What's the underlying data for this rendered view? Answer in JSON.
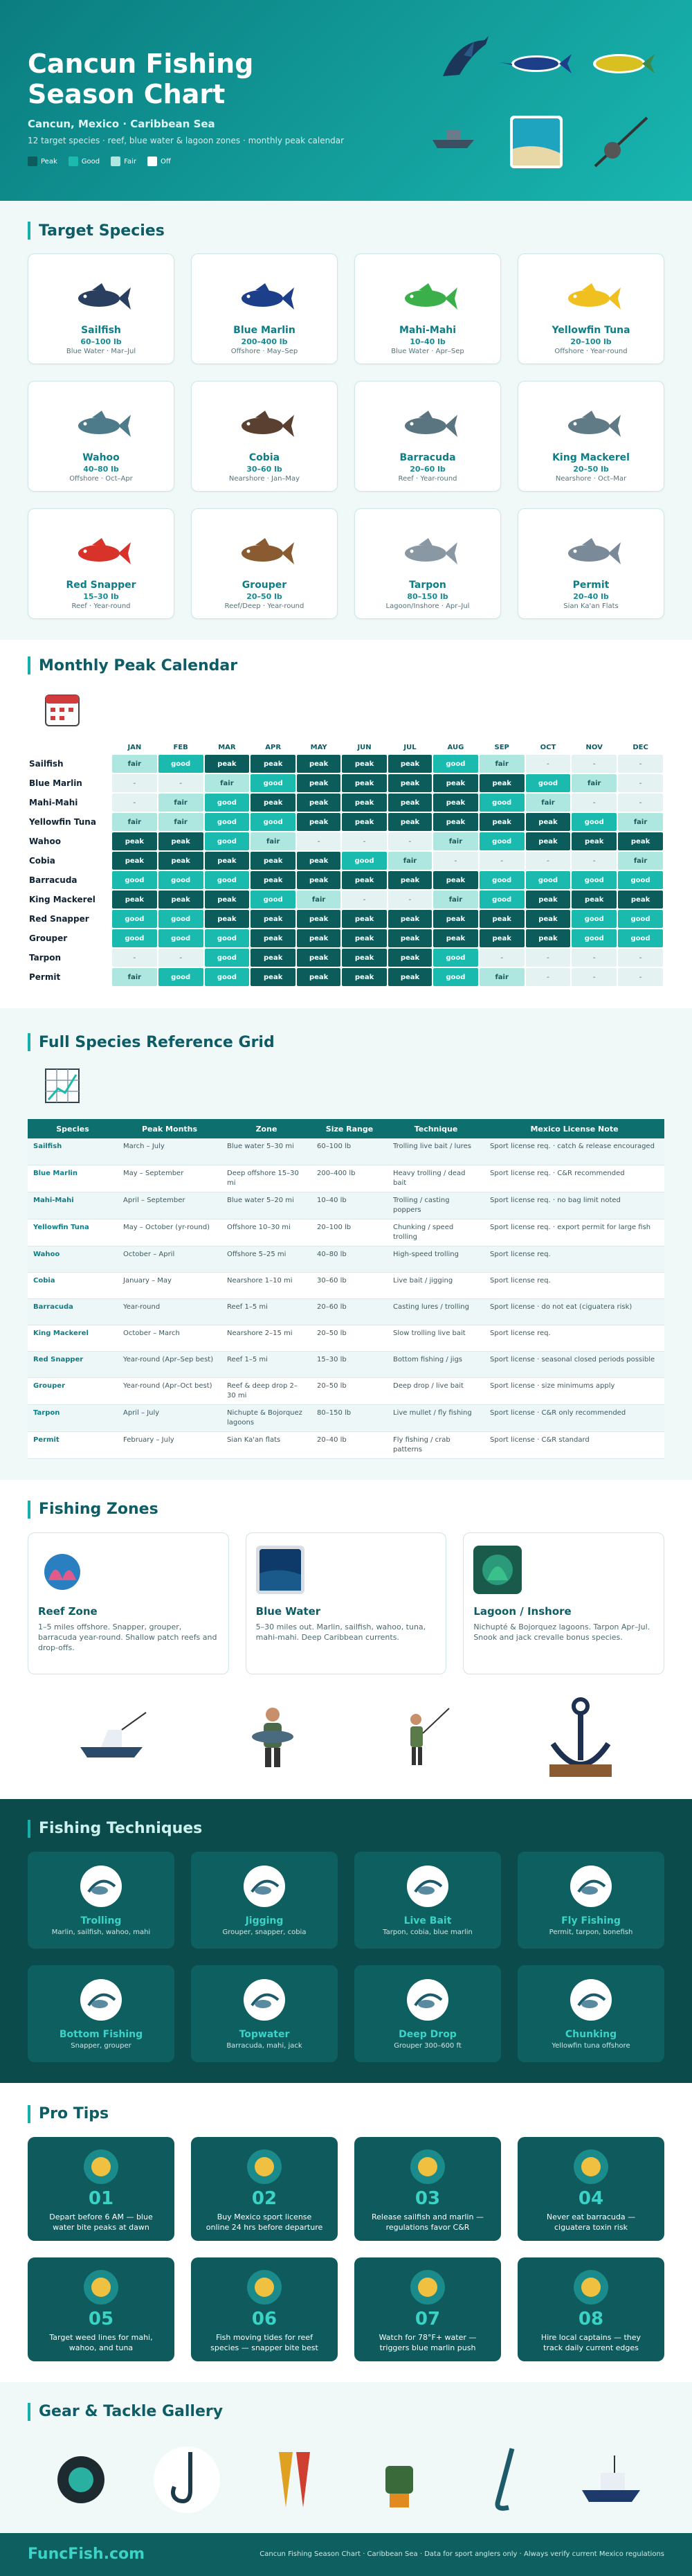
{
  "hero": {
    "title": "Cancun Fishing Season Chart",
    "subtitle": "Cancun, Mexico · Caribbean Sea",
    "description": "12 target species · reef, blue water & lagoon zones · monthly peak calendar",
    "legend": [
      {
        "label": "Peak",
        "color": "#0c5c5c"
      },
      {
        "label": "Good",
        "color": "#1abaae"
      },
      {
        "label": "Fair",
        "color": "#aee6e0"
      },
      {
        "label": "Off",
        "color": "#ffffff"
      }
    ]
  },
  "species_section": {
    "title": "Target Species"
  },
  "species": [
    {
      "name": "Sailfish",
      "weight": "60–100 lb",
      "desc": "Blue Water · Mar–Jul",
      "color": "#2a3f60",
      "icon": "sailfish-icon"
    },
    {
      "name": "Blue Marlin",
      "weight": "200–400 lb",
      "desc": "Offshore · May–Sep",
      "color": "#1d3f8a",
      "icon": "marlin-icon"
    },
    {
      "name": "Mahi-Mahi",
      "weight": "10–40 lb",
      "desc": "Blue Water · Apr–Sep",
      "color": "#3bb04a",
      "icon": "mahi-icon"
    },
    {
      "name": "Yellowfin Tuna",
      "weight": "20–100 lb",
      "desc": "Offshore · Year-round",
      "color": "#f0c020",
      "icon": "tuna-icon"
    },
    {
      "name": "Wahoo",
      "weight": "40–80 lb",
      "desc": "Offshore · Oct–Apr",
      "color": "#4d7b8a",
      "icon": "wahoo-icon"
    },
    {
      "name": "Cobia",
      "weight": "30–60 lb",
      "desc": "Nearshore · Jan–May",
      "color": "#5a4030",
      "icon": "cobia-icon"
    },
    {
      "name": "Barracuda",
      "weight": "20–60 lb",
      "desc": "Reef · Year-round",
      "color": "#5a7580",
      "icon": "barracuda-icon"
    },
    {
      "name": "King Mackerel",
      "weight": "20–50 lb",
      "desc": "Nearshore · Oct–Mar",
      "color": "#607a86",
      "icon": "mackerel-icon"
    },
    {
      "name": "Red Snapper",
      "weight": "15–30 lb",
      "desc": "Reef · Year-round",
      "color": "#d8332a",
      "icon": "snapper-icon"
    },
    {
      "name": "Grouper",
      "weight": "20–50 lb",
      "desc": "Reef/Deep · Year-round",
      "color": "#8a5a30",
      "icon": "grouper-icon"
    },
    {
      "name": "Tarpon",
      "weight": "80–150 lb",
      "desc": "Lagoon/Inshore · Apr–Jul",
      "color": "#8a98a4",
      "icon": "tarpon-icon"
    },
    {
      "name": "Permit",
      "weight": "20–40 lb",
      "desc": "Sian Ka'an Flats",
      "color": "#7a8a98",
      "icon": "permit-icon"
    }
  ],
  "calendar": {
    "title": "Monthly Peak Calendar",
    "icon": "calendar-icon",
    "months": [
      "JAN",
      "FEB",
      "MAR",
      "APR",
      "MAY",
      "JUN",
      "JUL",
      "AUG",
      "SEP",
      "OCT",
      "NOV",
      "DEC"
    ],
    "rows": [
      {
        "species": "Sailfish",
        "cells": [
          "fair",
          "good",
          "peak",
          "peak",
          "peak",
          "peak",
          "peak",
          "good",
          "fair",
          "-",
          "-",
          "-"
        ]
      },
      {
        "species": "Blue Marlin",
        "cells": [
          "-",
          "-",
          "fair",
          "good",
          "peak",
          "peak",
          "peak",
          "peak",
          "peak",
          "good",
          "fair",
          "-"
        ]
      },
      {
        "species": "Mahi-Mahi",
        "cells": [
          "-",
          "fair",
          "good",
          "peak",
          "peak",
          "peak",
          "peak",
          "peak",
          "good",
          "fair",
          "-",
          "-"
        ]
      },
      {
        "species": "Yellowfin Tuna",
        "cells": [
          "fair",
          "fair",
          "good",
          "good",
          "peak",
          "peak",
          "peak",
          "peak",
          "peak",
          "peak",
          "good",
          "fair"
        ]
      },
      {
        "species": "Wahoo",
        "cells": [
          "peak",
          "peak",
          "good",
          "fair",
          "-",
          "-",
          "-",
          "fair",
          "good",
          "peak",
          "peak",
          "peak"
        ]
      },
      {
        "species": "Cobia",
        "cells": [
          "peak",
          "peak",
          "peak",
          "peak",
          "peak",
          "good",
          "fair",
          "-",
          "-",
          "-",
          "-",
          "fair"
        ]
      },
      {
        "species": "Barracuda",
        "cells": [
          "good",
          "good",
          "good",
          "peak",
          "peak",
          "peak",
          "peak",
          "peak",
          "good",
          "good",
          "good",
          "good"
        ]
      },
      {
        "species": "King Mackerel",
        "cells": [
          "peak",
          "peak",
          "peak",
          "good",
          "fair",
          "-",
          "-",
          "fair",
          "good",
          "peak",
          "peak",
          "peak"
        ]
      },
      {
        "species": "Red Snapper",
        "cells": [
          "good",
          "good",
          "peak",
          "peak",
          "peak",
          "peak",
          "peak",
          "peak",
          "peak",
          "peak",
          "good",
          "good"
        ]
      },
      {
        "species": "Grouper",
        "cells": [
          "good",
          "good",
          "good",
          "peak",
          "peak",
          "peak",
          "peak",
          "peak",
          "peak",
          "peak",
          "good",
          "good"
        ]
      },
      {
        "species": "Tarpon",
        "cells": [
          "-",
          "-",
          "good",
          "peak",
          "peak",
          "peak",
          "peak",
          "good",
          "-",
          "-",
          "-",
          "-"
        ]
      },
      {
        "species": "Permit",
        "cells": [
          "fair",
          "good",
          "good",
          "peak",
          "peak",
          "peak",
          "peak",
          "good",
          "fair",
          "-",
          "-",
          "-"
        ]
      }
    ]
  },
  "reference": {
    "title": "Full Species Reference Grid",
    "icon": "grid-chart-icon",
    "columns": [
      "Species",
      "Peak Months",
      "Zone",
      "Size Range",
      "Technique",
      "Mexico License Note"
    ],
    "rows": [
      [
        "Sailfish",
        "March – July",
        "Blue water 5–30 mi",
        "60–100 lb",
        "Trolling live bait / lures",
        "Sport license req. · catch & release encouraged"
      ],
      [
        "Blue Marlin",
        "May – September",
        "Deep offshore 15–30 mi",
        "200–400 lb",
        "Heavy trolling / dead bait",
        "Sport license req. · C&R recommended"
      ],
      [
        "Mahi-Mahi",
        "April – September",
        "Blue water 5–20 mi",
        "10–40 lb",
        "Trolling / casting poppers",
        "Sport license req. · no bag limit noted"
      ],
      [
        "Yellowfin Tuna",
        "May – October (yr-round)",
        "Offshore 10–30 mi",
        "20–100 lb",
        "Chunking / speed trolling",
        "Sport license req. · export permit for large fish"
      ],
      [
        "Wahoo",
        "October – April",
        "Offshore 5–25 mi",
        "40–80 lb",
        "High-speed trolling",
        "Sport license req."
      ],
      [
        "Cobia",
        "January – May",
        "Nearshore 1–10 mi",
        "30–60 lb",
        "Live bait / jigging",
        "Sport license req."
      ],
      [
        "Barracuda",
        "Year-round",
        "Reef 1–5 mi",
        "20–60 lb",
        "Casting lures / trolling",
        "Sport license · do not eat (ciguatera risk)"
      ],
      [
        "King Mackerel",
        "October – March",
        "Nearshore 2–15 mi",
        "20–50 lb",
        "Slow trolling live bait",
        "Sport license req."
      ],
      [
        "Red Snapper",
        "Year-round (Apr–Sep best)",
        "Reef 1–5 mi",
        "15–30 lb",
        "Bottom fishing / jigs",
        "Sport license · seasonal closed periods possible"
      ],
      [
        "Grouper",
        "Year-round (Apr–Oct best)",
        "Reef & deep drop 2–30 mi",
        "20–50 lb",
        "Deep drop / live bait",
        "Sport license · size minimums apply"
      ],
      [
        "Tarpon",
        "April – July",
        "Nichupte & Bojorquez lagoons",
        "80–150 lb",
        "Live mullet / fly fishing",
        "Sport license · C&R only recommended"
      ],
      [
        "Permit",
        "February – July",
        "Sian Ka'an flats",
        "20–40 lb",
        "Fly fishing / crab patterns",
        "Sport license · C&R standard"
      ]
    ]
  },
  "zones": {
    "title": "Fishing Zones",
    "items": [
      {
        "name": "Reef Zone",
        "desc": "1–5 miles offshore. Snapper, grouper, barracuda year-round. Shallow patch reefs and drop-offs.",
        "icon": "reef-icon"
      },
      {
        "name": "Blue Water",
        "desc": "5–30 miles out. Marlin, sailfish, wahoo, tuna, mahi-mahi. Deep Caribbean currents.",
        "icon": "ocean-icon"
      },
      {
        "name": "Lagoon / Inshore",
        "desc": "Nichupté & Bojorquez lagoons. Tarpon Apr–Jul. Snook and jack crevalle bonus species.",
        "icon": "lagoon-icon"
      }
    ]
  },
  "techniques": {
    "title": "Fishing Techniques",
    "items": [
      {
        "name": "Trolling",
        "desc": "Marlin, sailfish, wahoo, mahi",
        "icon": "trolling-icon"
      },
      {
        "name": "Jigging",
        "desc": "Grouper, snapper, cobia",
        "icon": "jig-icon"
      },
      {
        "name": "Live Bait",
        "desc": "Tarpon, cobia, blue marlin",
        "icon": "bait-bucket-icon"
      },
      {
        "name": "Fly Fishing",
        "desc": "Permit, tarpon, bonefish",
        "icon": "fly-rod-icon"
      },
      {
        "name": "Bottom Fishing",
        "desc": "Snapper, grouper",
        "icon": "bottom-rig-icon"
      },
      {
        "name": "Topwater",
        "desc": "Barracuda, mahi, jack",
        "icon": "popper-lure-icon"
      },
      {
        "name": "Deep Drop",
        "desc": "Grouper 300–600 ft",
        "icon": "electric-reel-icon"
      },
      {
        "name": "Chunking",
        "desc": "Yellowfin tuna offshore",
        "icon": "chum-icon"
      }
    ]
  },
  "tips": {
    "title": "Pro Tips",
    "items": [
      {
        "num": "01",
        "text": "Depart before 6 AM — blue water bite peaks at dawn",
        "icon": "sunrise-icon"
      },
      {
        "num": "02",
        "text": "Buy Mexico sport license online 24 hrs before departure",
        "icon": "license-icon"
      },
      {
        "num": "03",
        "text": "Release sailfish and marlin — regulations favor C&R",
        "icon": "release-fish-icon"
      },
      {
        "num": "04",
        "text": "Never eat barracuda — ciguatera toxin risk",
        "icon": "no-fish-icon"
      },
      {
        "num": "05",
        "text": "Target weed lines for mahi, wahoo, and tuna",
        "icon": "seaweed-icon"
      },
      {
        "num": "06",
        "text": "Fish moving tides for reef species — snapper bite best",
        "icon": "tide-icon"
      },
      {
        "num": "07",
        "text": "Watch for 78°F+ water — triggers blue marlin push",
        "icon": "thermometer-icon"
      },
      {
        "num": "08",
        "text": "Hire local captains — they track daily current edges",
        "icon": "captain-icon"
      }
    ]
  },
  "gallery": {
    "title": "Gear & Tackle Gallery",
    "items": [
      "reel-icon",
      "hook-icon",
      "lures-icon",
      "fighting-chair-icon",
      "gaff-icon",
      "sportfishing-boat-icon"
    ]
  },
  "footer": {
    "brand": "FuncFish.com",
    "note": "Cancun Fishing Season Chart · Caribbean Sea · Data for sport anglers only · Always verify current Mexico regulations"
  }
}
